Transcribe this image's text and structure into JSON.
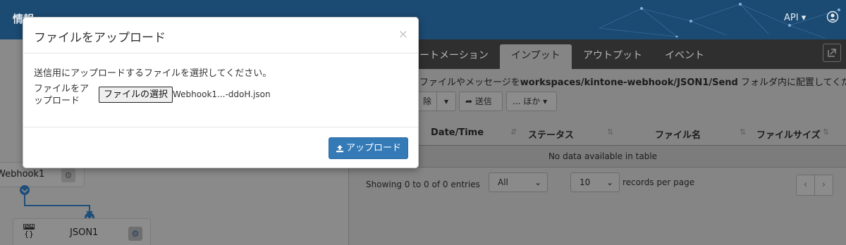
{
  "navbar": {
    "brand": "情報",
    "api_label": "API ▾"
  },
  "tabs": [
    {
      "label": "ートメーション"
    },
    {
      "label": "インプット"
    },
    {
      "label": "アウトプット"
    },
    {
      "label": "イベント"
    }
  ],
  "instruction": {
    "prefix": "ファイルやメッセージを",
    "path": "workspaces/kintone-webhook/JSON1/Send",
    "suffix": " フォルダ内に配置してください。"
  },
  "toolbar": {
    "delete_label": "除",
    "send_label": "送信",
    "more_label": "... ほか"
  },
  "table": {
    "columns": [
      "Date/Time",
      "ステータス",
      "ファイル名",
      "ファイルサイズ"
    ],
    "empty_text": "No data available in table",
    "showing_text": "Showing 0 to 0 of 0 entries",
    "filter_value": "All",
    "page_size_value": "10",
    "records_per_page": "records per page",
    "prev": "‹",
    "next": "›"
  },
  "flow": {
    "node1_label": "Webhook1",
    "node2_label": "JSON1",
    "json_badge": "JSON"
  },
  "modal": {
    "title": "ファイルをアップロード",
    "close": "×",
    "message": "送信用にアップロードするファイルを選択してください。",
    "file_label": "ファイルをアップロード",
    "choose_button": "ファイルの選択",
    "file_name": "Webhook1...-ddoH.json",
    "upload_button": "アップロード"
  },
  "colors": {
    "primary": "#337ab7",
    "navbar": "#1b4a72",
    "tabbar": "#2f2f2f"
  }
}
